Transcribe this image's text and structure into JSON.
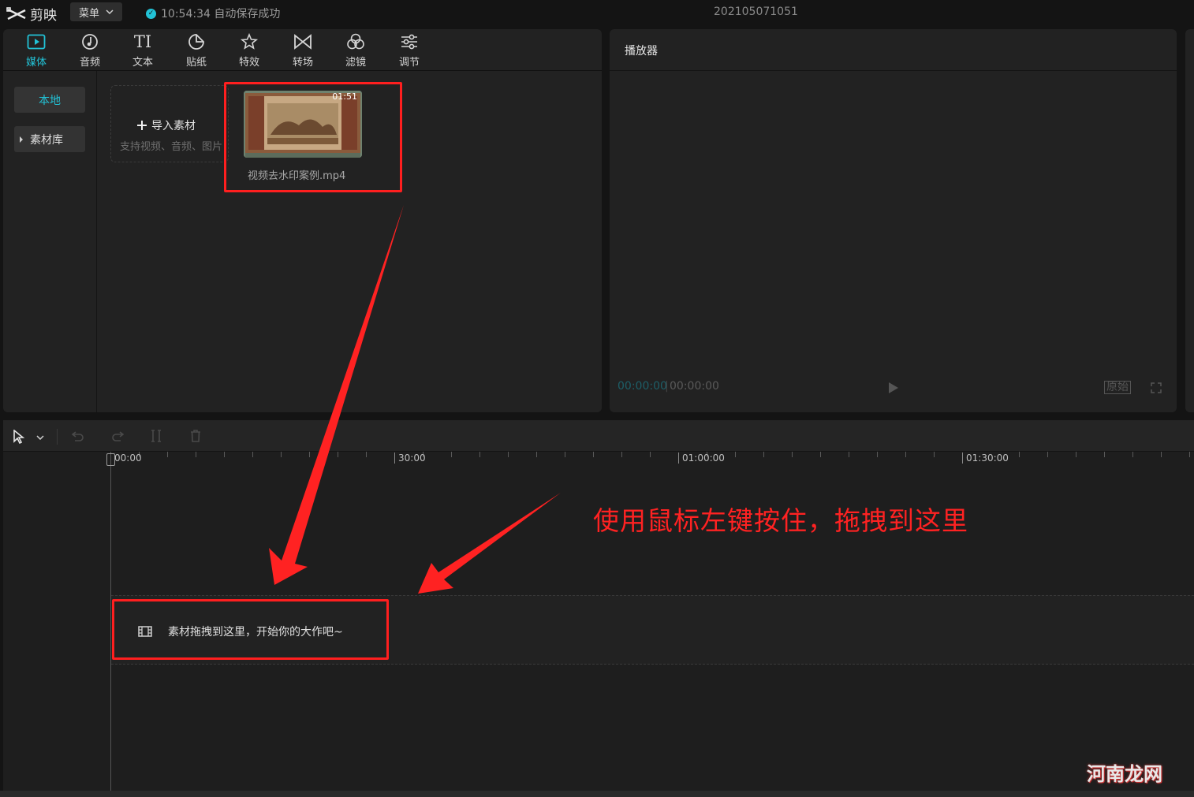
{
  "app": {
    "name": "剪映",
    "menu_label": "菜单",
    "save_status": "10:54:34 自动保存成功",
    "project_name": "202105071051"
  },
  "toolbar": {
    "tabs": [
      {
        "label": "媒体",
        "icon": "media-icon",
        "active": true
      },
      {
        "label": "音频",
        "icon": "audio-icon"
      },
      {
        "label": "文本",
        "icon": "text-icon"
      },
      {
        "label": "贴纸",
        "icon": "sticker-icon"
      },
      {
        "label": "特效",
        "icon": "effects-icon"
      },
      {
        "label": "转场",
        "icon": "transition-icon"
      },
      {
        "label": "滤镜",
        "icon": "filter-icon"
      },
      {
        "label": "调节",
        "icon": "adjust-icon"
      }
    ],
    "text_icon_glyph": "TI"
  },
  "sidebar": {
    "local_label": "本地",
    "library_label": "素材库"
  },
  "media": {
    "import_label": "导入素材",
    "import_hint": "支持视频、音频、图片",
    "items": [
      {
        "name": "视频去水印案例.mp4",
        "duration": "01:51"
      }
    ]
  },
  "player": {
    "title": "播放器",
    "current_time": "00:00:00",
    "total_time": "00:00:00",
    "ratio_label": "原始"
  },
  "timeline": {
    "ruler_labels": [
      "00:00",
      "30:00",
      "01:00:00",
      "01:30:00"
    ],
    "drop_hint": "素材拖拽到这里，开始你的大作吧~"
  },
  "annotation": {
    "text": "使用鼠标左键按住，拖拽到这里",
    "color": "#ff2222"
  },
  "watermark": {
    "text": "河南龙网"
  },
  "colors": {
    "accent": "#22c2d6",
    "panel": "#222222",
    "background": "#141414",
    "highlight_red": "#ff1f1f"
  }
}
